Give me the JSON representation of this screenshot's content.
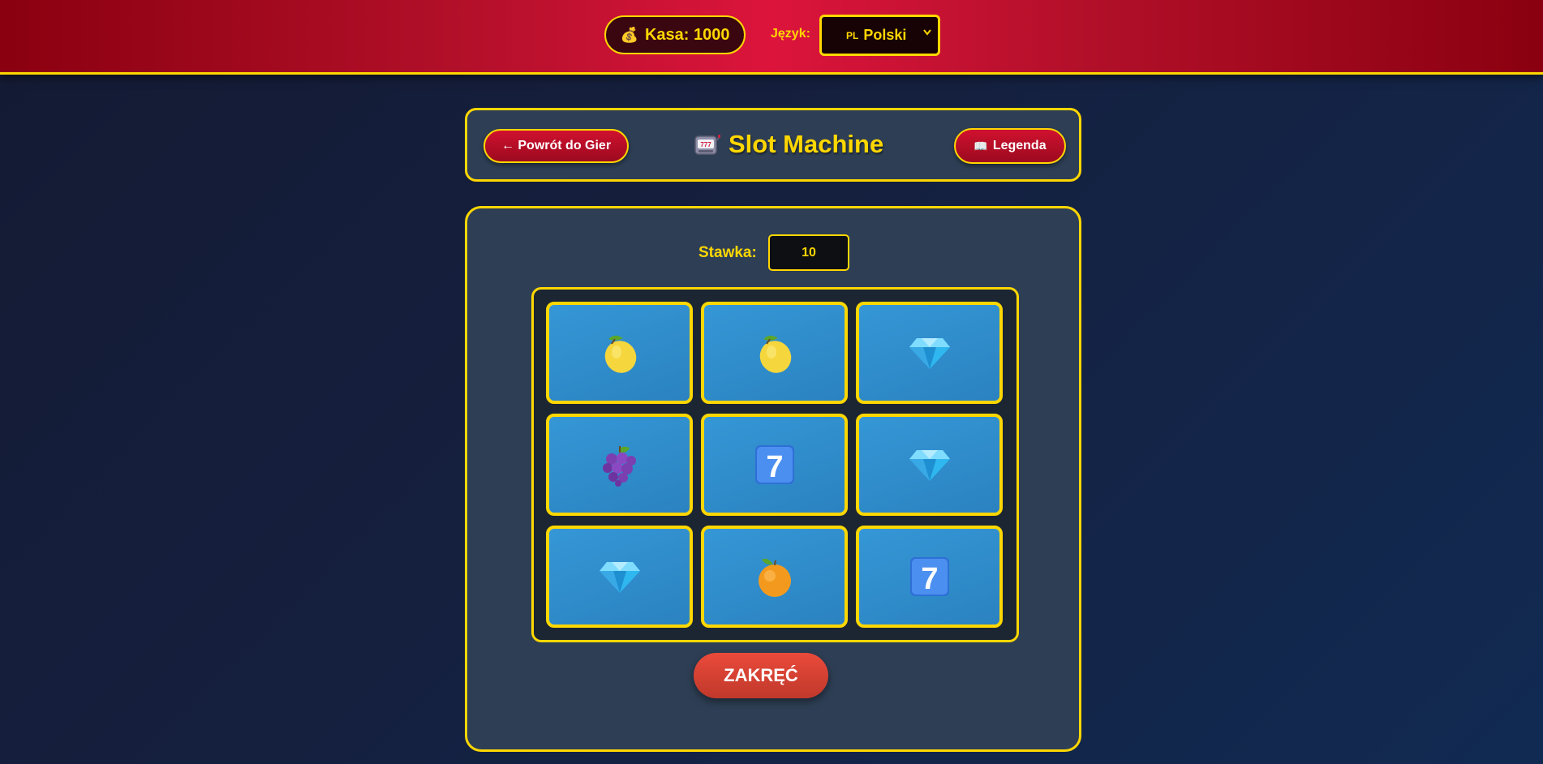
{
  "topbar": {
    "cash_label": "Kasa: 1000",
    "cash_icon": "money-bag-icon",
    "language_label": "Język:",
    "language_flag": "PL",
    "language_selected": "Polski"
  },
  "header": {
    "back_label": "← Powrót do Gier",
    "title": "Slot Machine",
    "title_icon": "slot-machine-icon",
    "legend_label": "Legenda",
    "legend_icon": "book-icon"
  },
  "game": {
    "bet_label": "Stawka:",
    "bet_value": "10",
    "spin_label": "ZAKRĘĆ",
    "reels": [
      [
        "lemon",
        "lemon",
        "diamond"
      ],
      [
        "grapes",
        "seven",
        "diamond"
      ],
      [
        "diamond",
        "orange",
        "seven"
      ]
    ]
  },
  "colors": {
    "accent_gold": "#ffd700",
    "topbar_red": "#dc143c",
    "panel_bg": "#2e3f55",
    "reel_cell_blue": "#3597d6",
    "spin_button": "#e74c3c"
  }
}
